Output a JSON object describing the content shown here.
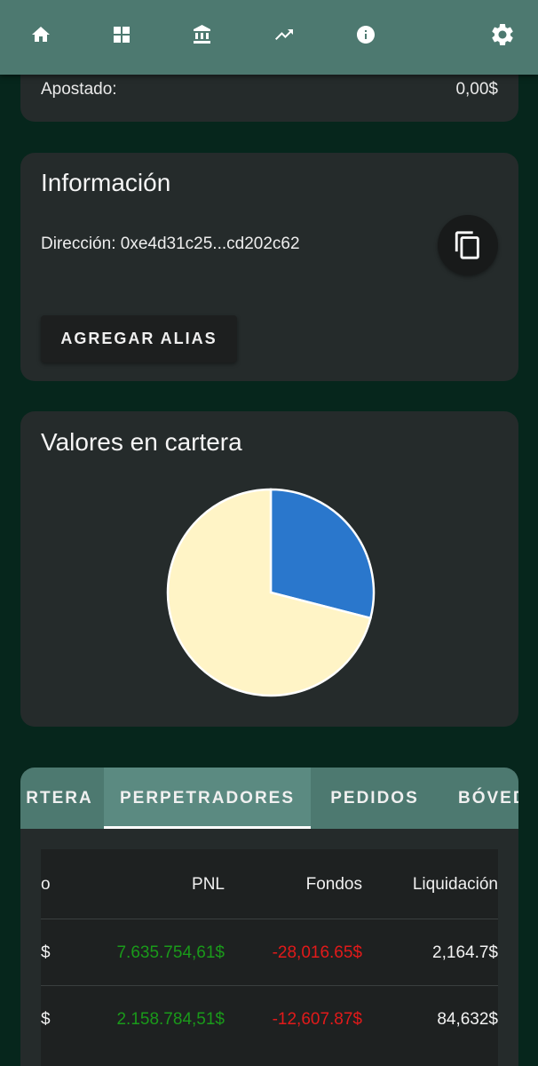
{
  "nav": {
    "items": [
      "home-icon",
      "dashboard-icon",
      "bank-icon",
      "trending-icon",
      "info-icon"
    ],
    "settings_icon": "gear-icon"
  },
  "wallet": {
    "bet_label": "Apostado:",
    "bet_value": "0,00$"
  },
  "info": {
    "title": "Información",
    "address": "Dirección: 0xe4d31c25...cd202c62",
    "add_alias_label": "AGREGAR ALIAS"
  },
  "values": {
    "title": "Valores en cartera",
    "chart_data": {
      "type": "pie",
      "values": [
        29,
        71
      ],
      "colors": [
        "#2a77cc",
        "#fff4c6"
      ]
    }
  },
  "tabs": {
    "items": [
      "RTERA",
      "PERPETRADORES",
      "PEDIDOS",
      "BÓVED"
    ],
    "active": 1
  },
  "table": {
    "headers": [
      "o",
      "PNL",
      "Fondos",
      "Liquidación"
    ],
    "rows": [
      [
        "$",
        "7.635.754,61$",
        "-28,016.65$",
        "2,164.7$"
      ],
      [
        "$",
        "2.158.784,51$",
        "-12,607.87$",
        "84,632$"
      ]
    ]
  },
  "colors": {
    "accent": "#4d7970",
    "positive": "#1a9a1a",
    "negative": "#e21a1a"
  }
}
